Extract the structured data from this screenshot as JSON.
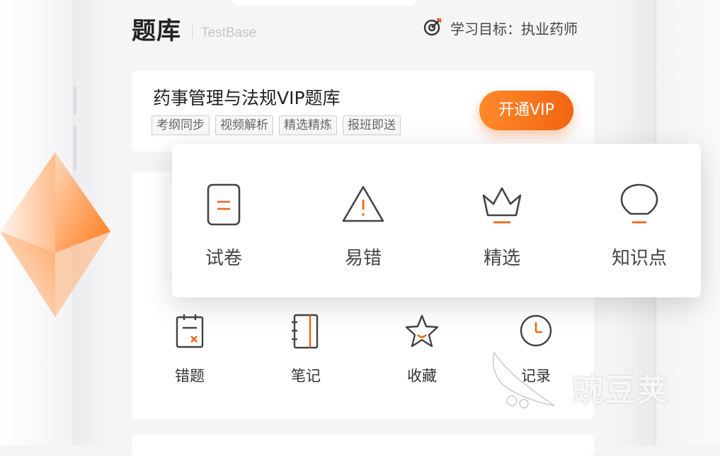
{
  "header": {
    "title": "题库",
    "subtitle": "TestBase",
    "goal_text": "学习目标：执业药师",
    "goal_icon": "target-icon"
  },
  "vip_card": {
    "title": "药事管理与法规VIP题库",
    "tags": [
      "考纲同步",
      "视频解析",
      "精选精炼",
      "报班即送"
    ],
    "button_label": "开通VIP"
  },
  "popup": {
    "items": [
      {
        "label": "试卷",
        "icon": "document-icon"
      },
      {
        "label": "易错",
        "icon": "warning-icon"
      },
      {
        "label": "精选",
        "icon": "crown-icon"
      },
      {
        "label": "知识点",
        "icon": "lightbulb-icon"
      }
    ]
  },
  "tools": {
    "items": [
      {
        "label": "错题",
        "icon": "wrong-clipboard-icon"
      },
      {
        "label": "笔记",
        "icon": "notebook-icon"
      },
      {
        "label": "收藏",
        "icon": "star-icon"
      },
      {
        "label": "记录",
        "icon": "clock-icon"
      }
    ]
  },
  "watermark": {
    "text": "豌豆荚"
  },
  "colors": {
    "accent": "#f26411",
    "accent_light": "#ff8a2a",
    "icon_stroke": "#444444",
    "background": "#f5f5f7"
  }
}
